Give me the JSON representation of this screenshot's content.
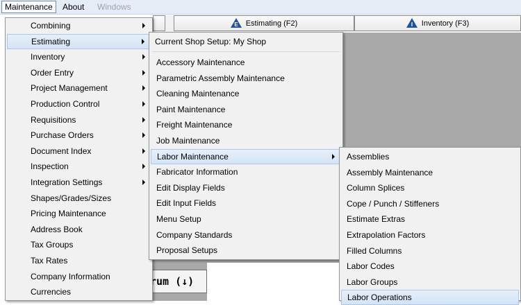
{
  "menubar": {
    "items": [
      {
        "label": "Maintenance",
        "state": "active"
      },
      {
        "label": "About",
        "state": "normal"
      },
      {
        "label": "Windows",
        "state": "disabled"
      }
    ]
  },
  "toolbar": {
    "estimating_label": "Estimating (F2)",
    "inventory_label": "Inventory (F3)"
  },
  "background": {
    "rum_button_label": "rum (↓)"
  },
  "maintenance_menu": {
    "items": [
      {
        "label": "Combining",
        "submenu": true
      },
      {
        "label": "Estimating",
        "submenu": true,
        "selected": true
      },
      {
        "label": "Inventory",
        "submenu": true
      },
      {
        "label": "Order Entry",
        "submenu": true
      },
      {
        "label": "Project Management",
        "submenu": true
      },
      {
        "label": "Production Control",
        "submenu": true
      },
      {
        "label": "Requisitions",
        "submenu": true
      },
      {
        "label": "Purchase Orders",
        "submenu": true
      },
      {
        "label": "Document Index",
        "submenu": true
      },
      {
        "label": "Inspection",
        "submenu": true
      },
      {
        "label": "Integration Settings",
        "submenu": true
      },
      {
        "label": "Shapes/Grades/Sizes",
        "submenu": false
      },
      {
        "label": "Pricing Maintenance",
        "submenu": false
      },
      {
        "label": "Address Book",
        "submenu": false
      },
      {
        "label": "Tax Groups",
        "submenu": false
      },
      {
        "label": "Tax Rates",
        "submenu": false
      },
      {
        "label": "Company Information",
        "submenu": false
      },
      {
        "label": "Currencies",
        "submenu": false
      }
    ]
  },
  "estimating_menu": {
    "header": "Current Shop Setup: My Shop",
    "items": [
      {
        "label": "Accessory Maintenance",
        "submenu": false
      },
      {
        "label": "Parametric Assembly Maintenance",
        "submenu": false
      },
      {
        "label": "Cleaning Maintenance",
        "submenu": false
      },
      {
        "label": "Paint Maintenance",
        "submenu": false
      },
      {
        "label": "Freight Maintenance",
        "submenu": false
      },
      {
        "label": "Job Maintenance",
        "submenu": false
      },
      {
        "label": "Labor Maintenance",
        "submenu": true,
        "selected": true
      },
      {
        "label": "Fabricator Information",
        "submenu": false
      },
      {
        "label": "Edit Display Fields",
        "submenu": false
      },
      {
        "label": "Edit Input Fields",
        "submenu": false
      },
      {
        "label": "Menu Setup",
        "submenu": false
      },
      {
        "label": "Company Standards",
        "submenu": false
      },
      {
        "label": "Proposal Setups",
        "submenu": false
      }
    ]
  },
  "labor_menu": {
    "items": [
      {
        "label": "Assemblies"
      },
      {
        "label": "Assembly Maintenance"
      },
      {
        "label": "Column Splices"
      },
      {
        "label": "Cope / Punch / Stiffeners"
      },
      {
        "label": "Estimate Extras"
      },
      {
        "label": "Extrapolation Factors"
      },
      {
        "label": "Filled Columns"
      },
      {
        "label": "Labor Codes"
      },
      {
        "label": "Labor Groups"
      },
      {
        "label": "Labor Operations",
        "selected": true
      }
    ]
  }
}
